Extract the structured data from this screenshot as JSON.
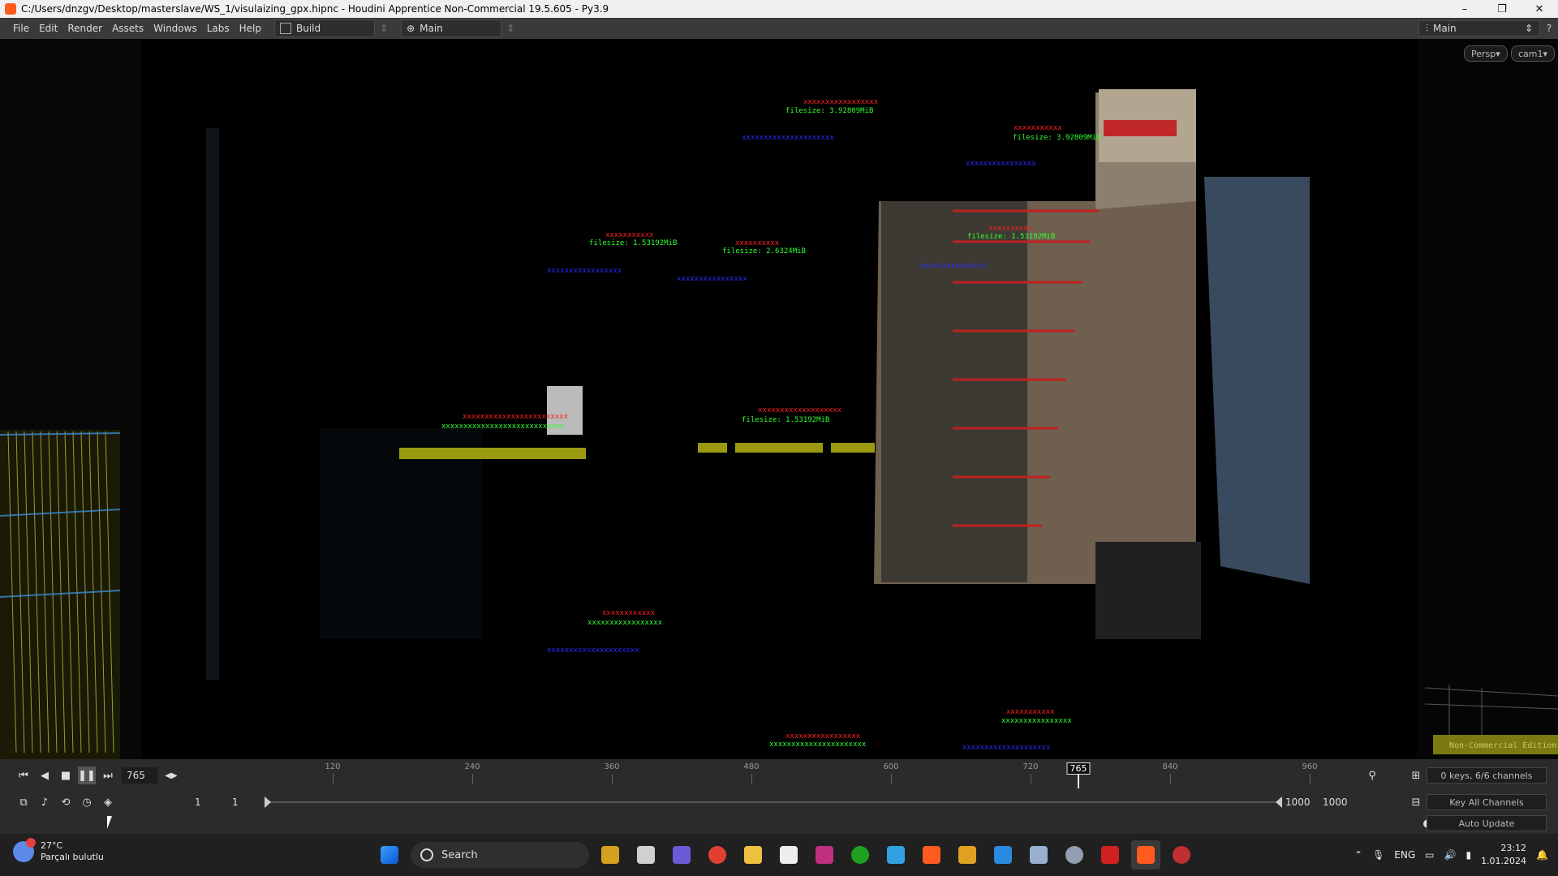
{
  "window": {
    "title": "C:/Users/dnzgv/Desktop/masterslave/WS_1/visulaizing_gpx.hipnc - Houdini Apprentice Non-Commercial 19.5.605 - Py3.9",
    "controls": [
      "–",
      "❐",
      "✕"
    ]
  },
  "menubar": {
    "items": [
      "File",
      "Edit",
      "Render",
      "Assets",
      "Windows",
      "Labs",
      "Help"
    ],
    "desktop_label": "Build",
    "pane_label": "Main",
    "right_desktop": "Main"
  },
  "viewport": {
    "camera_menu": "Persp",
    "cam_menu": "cam1",
    "watermark": "Non-Commercial Edition",
    "overlay_labels": {
      "fs1": "filesize: 1.53192MiB",
      "fs2": "filesize: 2.6324MiB",
      "fs3": "filesize: 3.92809MiB",
      "fs4": "filesize: 1.53192MiB",
      "fs5": "filesize: 1.53192MiB",
      "fs6": "filesize: 3.92809MiB"
    }
  },
  "timeline": {
    "current_frame": "765",
    "cursor_label": "765",
    "ruler_labels": [
      "120",
      "240",
      "360",
      "480",
      "600",
      "720",
      "840",
      "960"
    ],
    "range_start_a": "1",
    "range_start_b": "1",
    "range_end_a": "1000",
    "range_end_b": "1000",
    "keys_info": "0 keys, 6/6 channels",
    "key_all": "Key All Channels",
    "auto_update": "Auto Update"
  },
  "taskbar": {
    "weather_temp": "27°C",
    "weather_desc": "Parçalı bulutlu",
    "search_label": "Search",
    "lang": "ENG",
    "time": "23:12",
    "date": "1.01.2024"
  },
  "colors": {
    "accent_orange": "#ff5a1f",
    "label_red": "#ff2020",
    "label_green": "#30ff30",
    "label_blue": "#2a2aff",
    "bar_olive": "#9a9a10"
  }
}
